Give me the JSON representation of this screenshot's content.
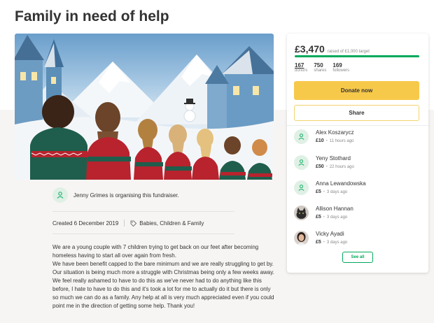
{
  "page": {
    "title": "Family in need of help"
  },
  "hero": {
    "image_icon": "family-christmas-illustration"
  },
  "organiser": {
    "text": "Jenny Grimes is organising this fundraiser.",
    "icon": "user-heart-icon"
  },
  "meta": {
    "created": "Created 6 December 2019",
    "category": "Babies, Children & Family",
    "category_icon": "tag-icon"
  },
  "story": {
    "paragraphs": [
      "We are a young couple with 7 children trying to get back on our feet after becoming homeless having to start all over again from fresh.",
      "We have been benefit capped to the bare minimum and we are really struggling to get by. Our situation is being much more a struggle with Christmas being only a few weeks away. We feel really ashamed to have to do this as we've never had to do anything like this before, I hate to have to do this and it's took a lot for me to actually do it but there is only so much we can do as a family. Any help at all is very much appreciated even if you could point me in the direction of getting some help. Thank you!"
    ]
  },
  "sidebar": {
    "amount": "£3,470",
    "raised_of": "raised of £1,000 target",
    "progress_fraction": 1.0,
    "stats": [
      {
        "value": "167",
        "label": "donors"
      },
      {
        "value": "750",
        "label": "shares"
      },
      {
        "value": "169",
        "label": "followers"
      }
    ],
    "donate_label": "Donate now",
    "share_label": "Share",
    "see_all_label": "See all",
    "donations": [
      {
        "name": "Alex Koszarycz",
        "amount": "£10",
        "time": "11 hours ago",
        "avatar": "user-heart-icon"
      },
      {
        "name": "Yeny Stothard",
        "amount": "£50",
        "time": "22 hours ago",
        "avatar": "user-heart-icon"
      },
      {
        "name": "Anna Lewandowska",
        "amount": "£5",
        "time": "3 days ago",
        "avatar": "user-heart-icon"
      },
      {
        "name": "Allison Hannan",
        "amount": "£5",
        "time": "3 days ago",
        "avatar": "cat-photo"
      },
      {
        "name": "Vicky Ayadi",
        "amount": "£5",
        "time": "3 days ago",
        "avatar": "person-photo"
      }
    ]
  },
  "colors": {
    "accent_green": "#02a95c",
    "donate_yellow": "#f7c94a",
    "text": "#333333"
  }
}
